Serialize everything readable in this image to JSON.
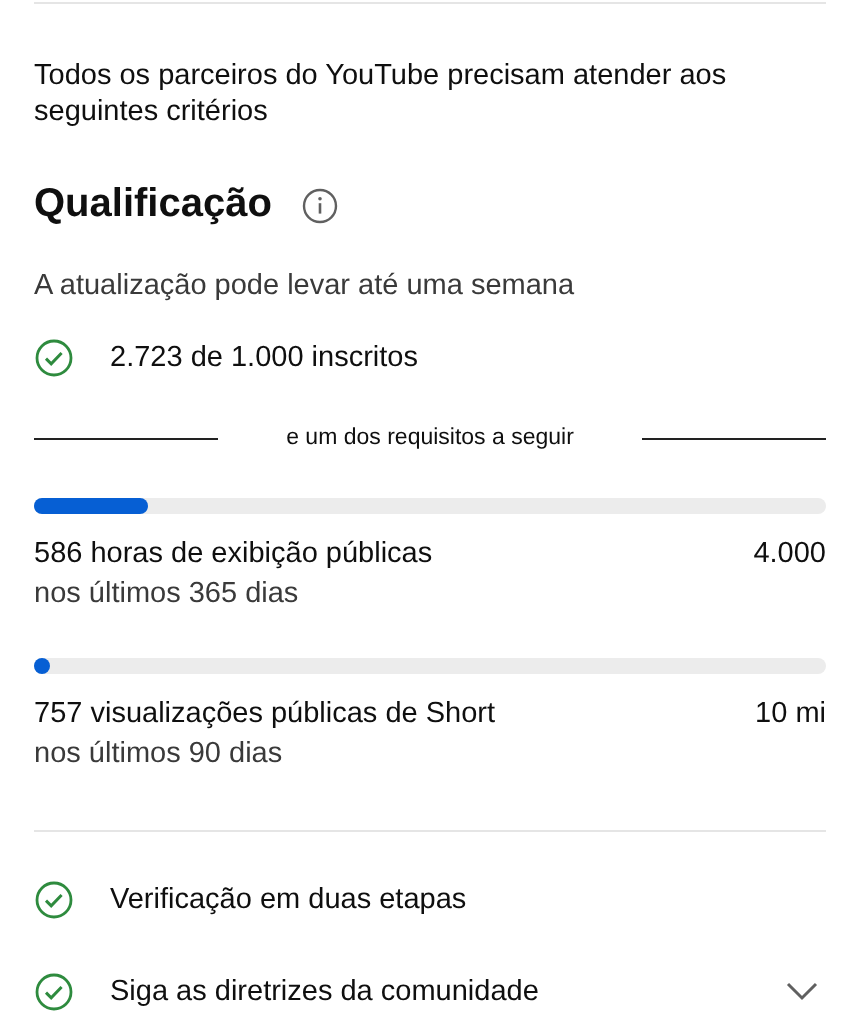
{
  "intro": "Todos os parceiros do YouTube precisam atender aos seguintes critérios",
  "section": {
    "title": "Qualificação",
    "note": "A atualização pode levar até uma semana"
  },
  "subscribers": {
    "text": "2.723 de 1.000 inscritos",
    "met": true
  },
  "separator": "e um dos requisitos a seguir",
  "metrics": [
    {
      "level": 0.145,
      "label": "586 horas de exibição públicas",
      "period": "nos últimos 365 dias",
      "target": "4.000"
    },
    {
      "level": 0.0,
      "label": "757 visualizações públicas de Short",
      "period": "nos últimos 90 dias",
      "target": "10 mi"
    }
  ],
  "requirements": [
    {
      "kind": "plain",
      "text": "Verificação em duas etapas",
      "met": true
    },
    {
      "kind": "expandable",
      "text": "Siga as diretrizes da comunidade",
      "met": true,
      "expanded": false
    }
  ]
}
